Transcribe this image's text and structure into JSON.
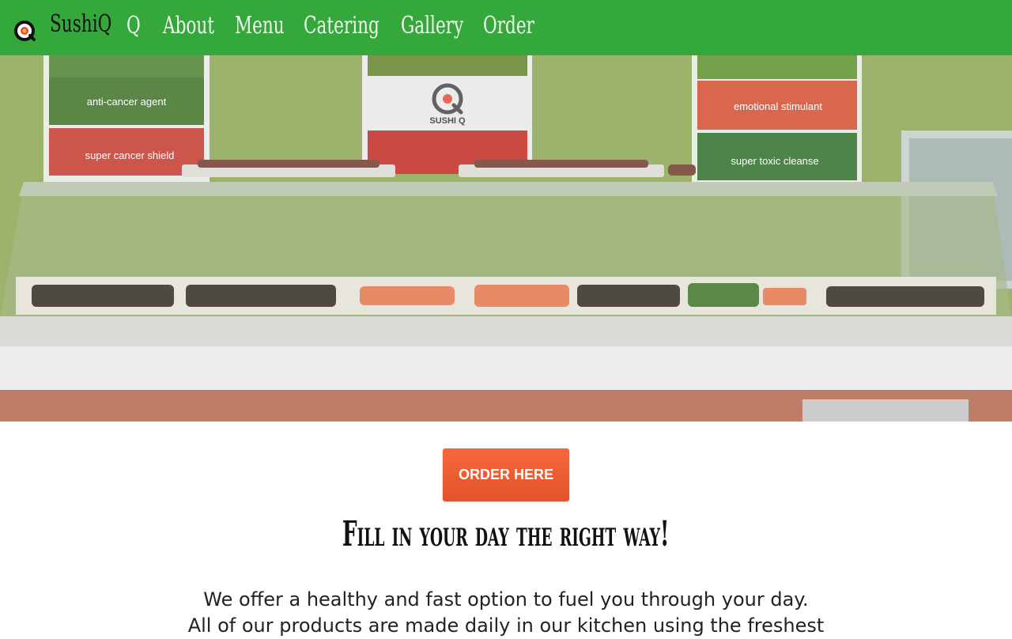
{
  "nav": {
    "brand": "SushiQ",
    "links": [
      "Q",
      "About",
      "Menu",
      "Catering",
      "Gallery",
      "Order"
    ]
  },
  "hero": {
    "signs": [
      "anti-cancer agent",
      "super cancer shield",
      "SUSHI Q",
      "emotional stimulant",
      "super toxic cleanse"
    ]
  },
  "cta": {
    "label": "ORDER HERE"
  },
  "tagline": "Fill in your day the right way!",
  "intro": {
    "line1": "We offer a healthy and fast option to fuel you through your day.",
    "line2": "All of our products are made daily in our kitchen using the freshest"
  },
  "colors": {
    "nav_bg": "#35a83c",
    "cta_bg": "#e9582e",
    "wall": "#7e9a3b"
  }
}
